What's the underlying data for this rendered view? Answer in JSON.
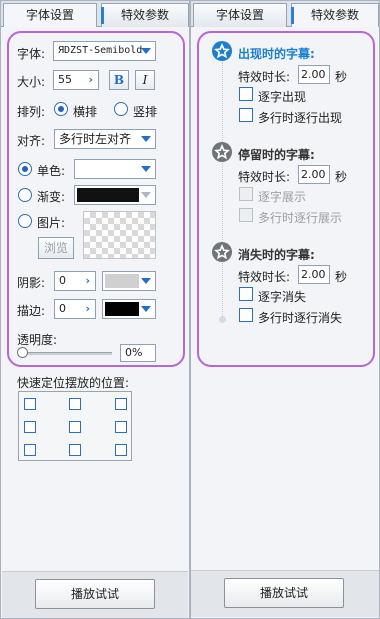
{
  "left": {
    "tabs": [
      "字体设置",
      "特效参数"
    ],
    "font": {
      "label": "字体:",
      "value": "ЯDZST-Semibold"
    },
    "size": {
      "label": "大小:",
      "value": "55"
    },
    "bold_label": "B",
    "italic_label": "I",
    "layout": {
      "label": "排列:",
      "options": [
        "横排",
        "竖排"
      ],
      "selected": "横排"
    },
    "align": {
      "label": "对齐:",
      "value": "多行时左对齐"
    },
    "fill": {
      "solid_label": "单色:",
      "gradient_label": "渐变:",
      "image_label": "图片:",
      "browse_label": "浏览",
      "selected": "单色",
      "gradient_color": "#111111"
    },
    "shadow": {
      "label": "阴影:",
      "value": "0",
      "color": "#d0d0d0"
    },
    "stroke": {
      "label": "描边:",
      "value": "0",
      "color": "#000000"
    },
    "opacity": {
      "label": "透明度:",
      "value": "0%",
      "level": 0
    },
    "position_label": "快速定位摆放的位置:",
    "play_label": "播放试试"
  },
  "right": {
    "tabs": [
      "字体设置",
      "特效参数"
    ],
    "appear": {
      "title": "出现时的字幕:",
      "duration_label": "特效时长:",
      "duration": "2.00",
      "unit": "秒",
      "opt1": "逐字出现",
      "opt2": "多行时逐行出现",
      "color": "#1a7fd0"
    },
    "stay": {
      "title": "停留时的字幕:",
      "duration_label": "特效时长:",
      "duration": "2.00",
      "unit": "秒",
      "opt1": "逐字展示",
      "opt2": "多行时逐行展示"
    },
    "vanish": {
      "title": "消失时的字幕:",
      "duration_label": "特效时长:",
      "duration": "2.00",
      "unit": "秒",
      "opt1": "逐字消失",
      "opt2": "多行时逐行消失"
    },
    "play_label": "播放试试"
  }
}
